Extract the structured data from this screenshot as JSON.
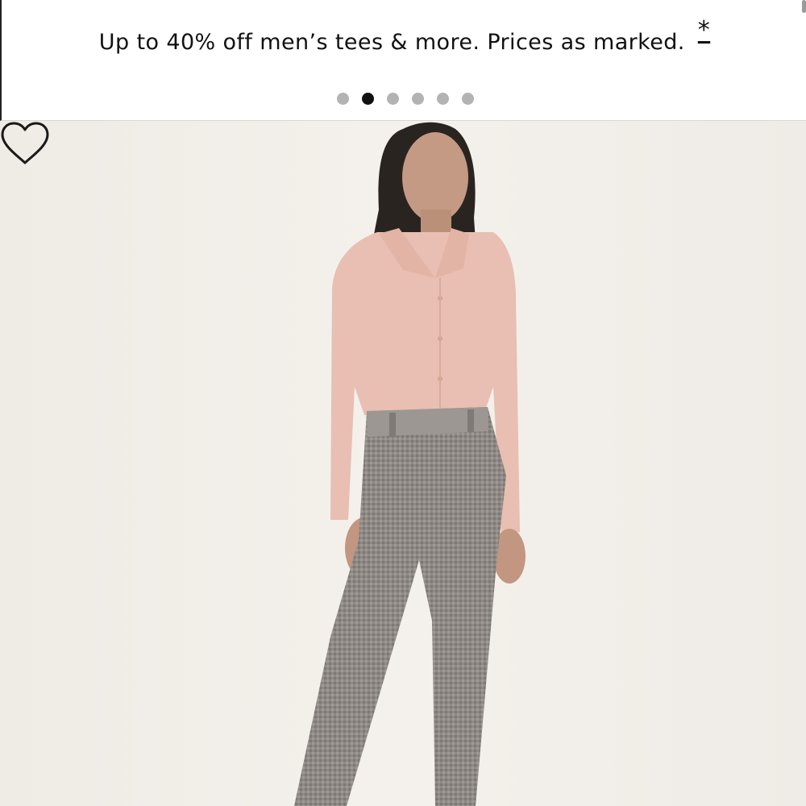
{
  "promo": {
    "text": "Up to 40% off men’s tees & more. Prices as marked.",
    "asterisk": "*"
  },
  "carousel": {
    "slide_count": 6,
    "active_index": 1
  },
  "product": {
    "image": "model-pink-blouse-gray-pants",
    "wishlist_icon": "heart-outline-icon"
  },
  "colors": {
    "background": "#f2eee8",
    "blouse": "#e8bfb2",
    "pants": "#8c8782",
    "dot_active": "#111111",
    "dot_inactive": "#b3b3b3"
  }
}
